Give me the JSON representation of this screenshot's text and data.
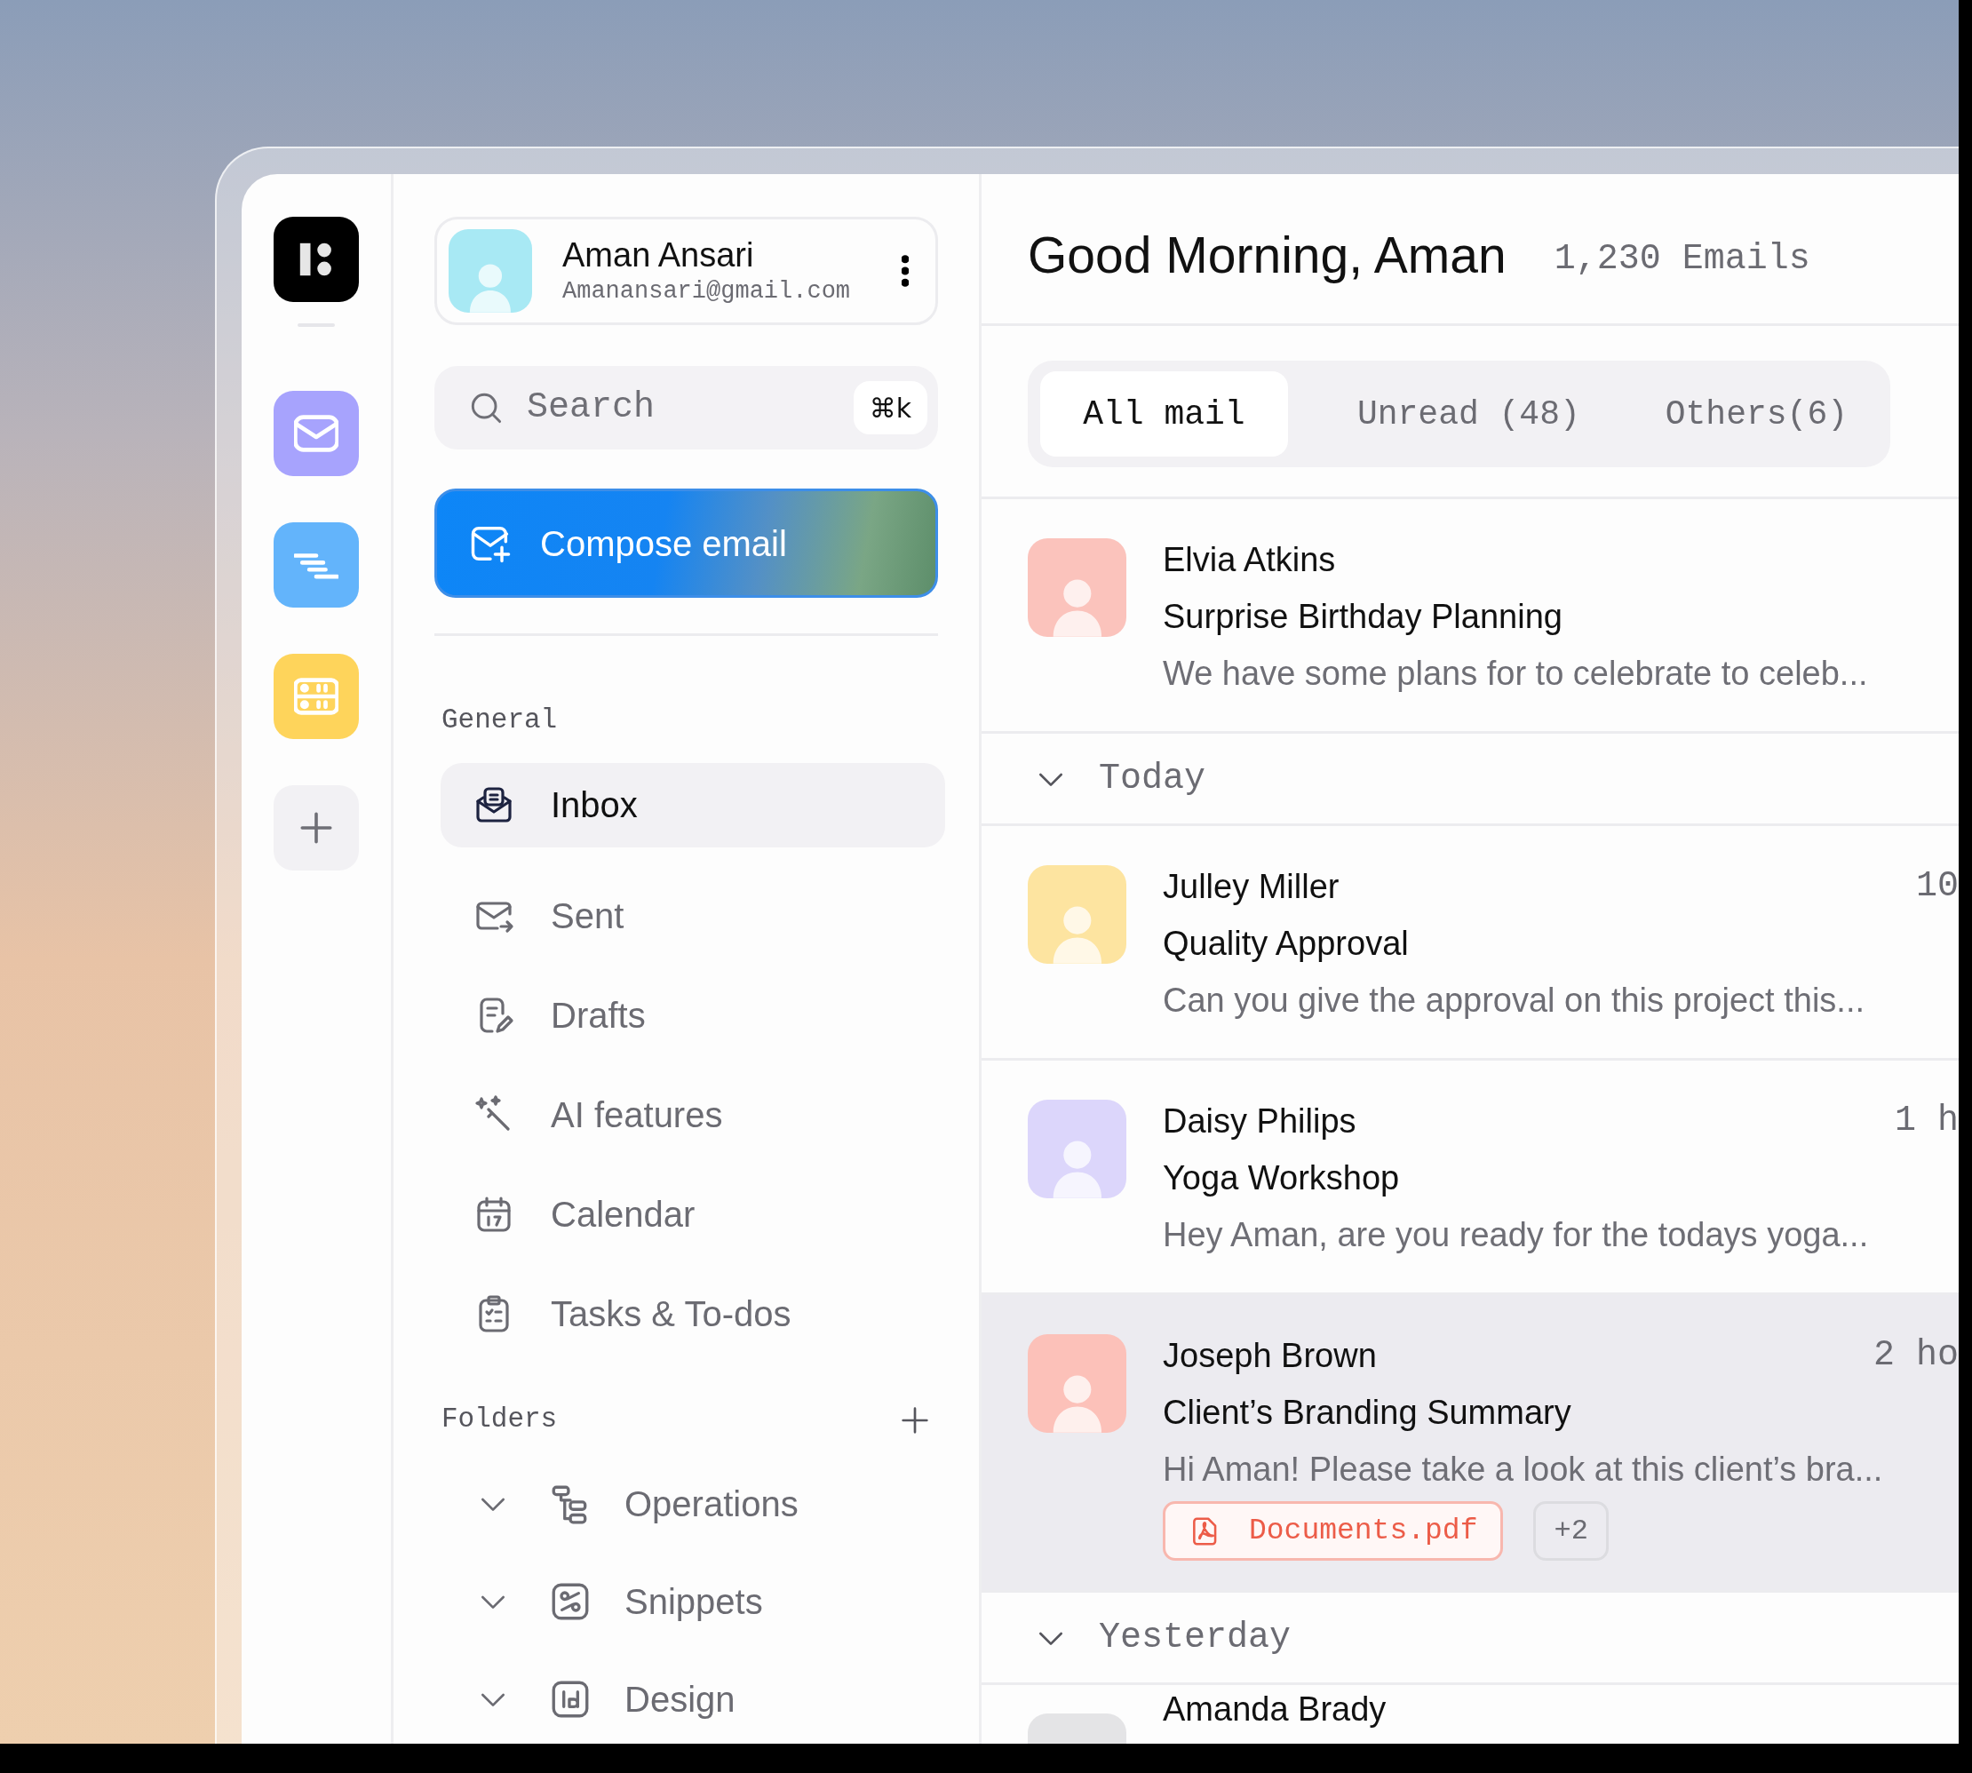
{
  "profile": {
    "name": "Aman Ansari",
    "email": "Amanansari@gmail.com"
  },
  "search": {
    "placeholder": "Search",
    "shortcut": "⌘k"
  },
  "compose_button": "Compose email",
  "general": {
    "label": "General",
    "items": [
      {
        "label": "Inbox",
        "kind": "inbox",
        "selected": true
      },
      {
        "label": "Sent",
        "kind": "sent",
        "selected": false
      },
      {
        "label": "Drafts",
        "kind": "drafts",
        "selected": false
      },
      {
        "label": "AI features",
        "kind": "ai",
        "selected": false
      },
      {
        "label": "Calendar",
        "kind": "calendar",
        "selected": false
      },
      {
        "label": "Tasks & To-dos",
        "kind": "tasks",
        "selected": false
      }
    ]
  },
  "folders": {
    "label": "Folders",
    "items": [
      {
        "label": "Operations",
        "kind": "operations"
      },
      {
        "label": "Snippets",
        "kind": "snippets"
      },
      {
        "label": "Design",
        "kind": "design"
      }
    ]
  },
  "header": {
    "title": "Good Morning, Aman",
    "count": "1,230 Emails"
  },
  "tabs": [
    {
      "label": "All mail",
      "selected": true
    },
    {
      "label": "Unread (48)",
      "selected": false
    },
    {
      "label": "Others(6)",
      "selected": false
    }
  ],
  "mail_list": [
    {
      "kind": "email",
      "sender": "Elvia Atkins",
      "subject": "Surprise Birthday Planning",
      "preview": "We have some plans for to celebrate to celeb...",
      "color": "#fbc3bc",
      "selected": false
    },
    {
      "kind": "section",
      "label": "Today",
      "expanded": true
    },
    {
      "kind": "email",
      "sender": "Julley Miller",
      "time": "10",
      "subject": "Quality Approval",
      "preview": "Can you give the approval on this project this...",
      "color": "#fde4a0",
      "selected": false
    },
    {
      "kind": "email",
      "sender": "Daisy Philips",
      "time": "1 h",
      "subject": "Yoga Workshop",
      "preview": "Hey Aman, are you ready for the todays yoga...",
      "color": "#dcd6fb",
      "selected": false
    },
    {
      "kind": "email",
      "sender": "Joseph Brown",
      "time": "2 ho",
      "subject": "Client’s Branding Summary",
      "preview": "Hi Aman! Please take a look at this client’s bra...",
      "color": "#fcc1b9",
      "selected": true,
      "attachments": [
        "Documents.pdf"
      ],
      "more_attachments": "+2"
    },
    {
      "kind": "section",
      "label": "Yesterday",
      "expanded": true
    },
    {
      "kind": "email",
      "sender": "Amanda Brady",
      "color": "#e4e4e6",
      "selected": false
    }
  ]
}
